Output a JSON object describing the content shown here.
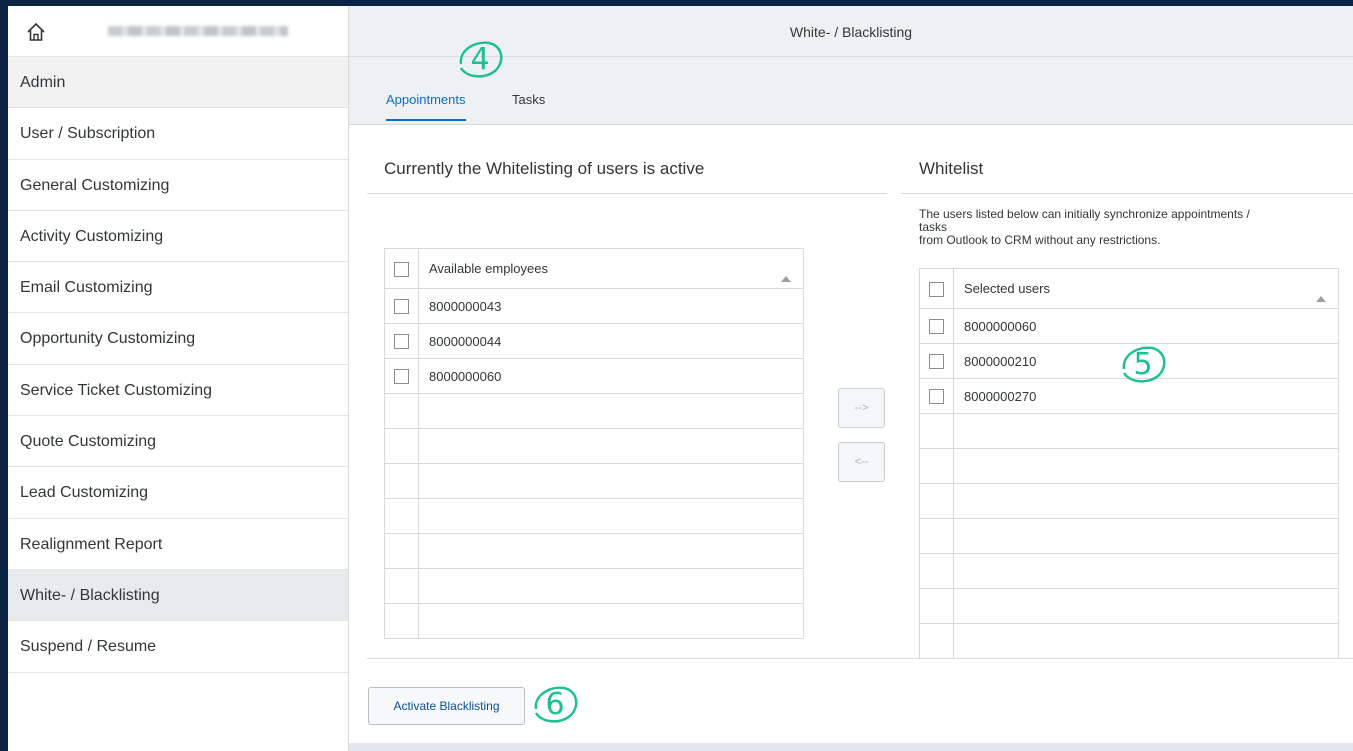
{
  "header": {
    "title": "White- / Blacklisting"
  },
  "sidebar": {
    "items": [
      {
        "label": "Admin"
      },
      {
        "label": "User / Subscription"
      },
      {
        "label": "General Customizing"
      },
      {
        "label": "Activity Customizing"
      },
      {
        "label": "Email Customizing"
      },
      {
        "label": "Opportunity Customizing"
      },
      {
        "label": "Service Ticket Customizing"
      },
      {
        "label": "Quote Customizing"
      },
      {
        "label": "Lead Customizing"
      },
      {
        "label": "Realignment Report"
      },
      {
        "label": "White- / Blacklisting"
      },
      {
        "label": "Suspend / Resume"
      }
    ]
  },
  "tabs": [
    {
      "label": "Appointments"
    },
    {
      "label": "Tasks"
    }
  ],
  "left_panel": {
    "title": "Currently the Whitelisting of users is active",
    "column_header": "Available employees",
    "rows": [
      "8000000043",
      "8000000044",
      "8000000060"
    ]
  },
  "right_panel": {
    "title": "Whitelist",
    "description_line1": "The users listed below can initially synchronize appointments /",
    "description_line2": "tasks",
    "description_line3": "from Outlook to CRM without any restrictions.",
    "column_header": "Selected users",
    "rows": [
      "8000000060",
      "8000000210",
      "8000000270"
    ]
  },
  "buttons": {
    "move_right": "-->",
    "move_left": "<--",
    "activate": "Activate Blacklisting"
  },
  "annotations": {
    "c4": "4",
    "c5": "5",
    "c6": "6"
  },
  "colors": {
    "accent": "#0a6ed1",
    "callout": "#1ec08f",
    "background": "#0b2345"
  }
}
